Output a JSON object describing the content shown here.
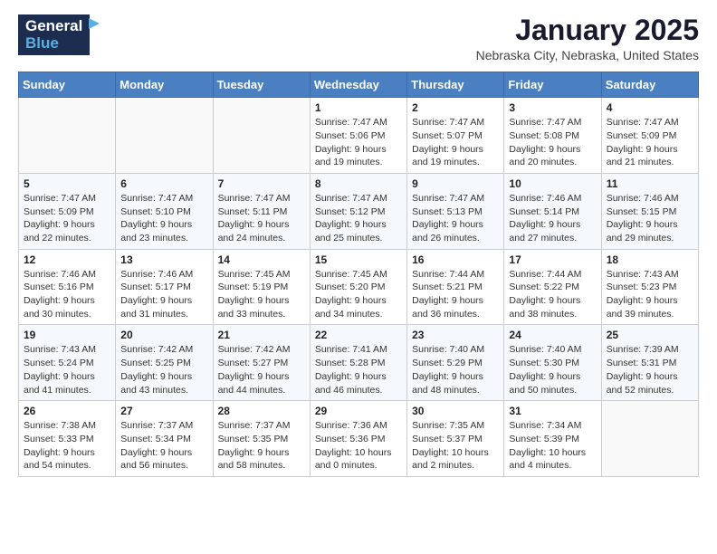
{
  "header": {
    "logo_line1": "General",
    "logo_line2": "Blue",
    "month": "January 2025",
    "location": "Nebraska City, Nebraska, United States"
  },
  "weekdays": [
    "Sunday",
    "Monday",
    "Tuesday",
    "Wednesday",
    "Thursday",
    "Friday",
    "Saturday"
  ],
  "weeks": [
    [
      {
        "day": "",
        "info": ""
      },
      {
        "day": "",
        "info": ""
      },
      {
        "day": "",
        "info": ""
      },
      {
        "day": "1",
        "info": "Sunrise: 7:47 AM\nSunset: 5:06 PM\nDaylight: 9 hours\nand 19 minutes."
      },
      {
        "day": "2",
        "info": "Sunrise: 7:47 AM\nSunset: 5:07 PM\nDaylight: 9 hours\nand 19 minutes."
      },
      {
        "day": "3",
        "info": "Sunrise: 7:47 AM\nSunset: 5:08 PM\nDaylight: 9 hours\nand 20 minutes."
      },
      {
        "day": "4",
        "info": "Sunrise: 7:47 AM\nSunset: 5:09 PM\nDaylight: 9 hours\nand 21 minutes."
      }
    ],
    [
      {
        "day": "5",
        "info": "Sunrise: 7:47 AM\nSunset: 5:09 PM\nDaylight: 9 hours\nand 22 minutes."
      },
      {
        "day": "6",
        "info": "Sunrise: 7:47 AM\nSunset: 5:10 PM\nDaylight: 9 hours\nand 23 minutes."
      },
      {
        "day": "7",
        "info": "Sunrise: 7:47 AM\nSunset: 5:11 PM\nDaylight: 9 hours\nand 24 minutes."
      },
      {
        "day": "8",
        "info": "Sunrise: 7:47 AM\nSunset: 5:12 PM\nDaylight: 9 hours\nand 25 minutes."
      },
      {
        "day": "9",
        "info": "Sunrise: 7:47 AM\nSunset: 5:13 PM\nDaylight: 9 hours\nand 26 minutes."
      },
      {
        "day": "10",
        "info": "Sunrise: 7:46 AM\nSunset: 5:14 PM\nDaylight: 9 hours\nand 27 minutes."
      },
      {
        "day": "11",
        "info": "Sunrise: 7:46 AM\nSunset: 5:15 PM\nDaylight: 9 hours\nand 29 minutes."
      }
    ],
    [
      {
        "day": "12",
        "info": "Sunrise: 7:46 AM\nSunset: 5:16 PM\nDaylight: 9 hours\nand 30 minutes."
      },
      {
        "day": "13",
        "info": "Sunrise: 7:46 AM\nSunset: 5:17 PM\nDaylight: 9 hours\nand 31 minutes."
      },
      {
        "day": "14",
        "info": "Sunrise: 7:45 AM\nSunset: 5:19 PM\nDaylight: 9 hours\nand 33 minutes."
      },
      {
        "day": "15",
        "info": "Sunrise: 7:45 AM\nSunset: 5:20 PM\nDaylight: 9 hours\nand 34 minutes."
      },
      {
        "day": "16",
        "info": "Sunrise: 7:44 AM\nSunset: 5:21 PM\nDaylight: 9 hours\nand 36 minutes."
      },
      {
        "day": "17",
        "info": "Sunrise: 7:44 AM\nSunset: 5:22 PM\nDaylight: 9 hours\nand 38 minutes."
      },
      {
        "day": "18",
        "info": "Sunrise: 7:43 AM\nSunset: 5:23 PM\nDaylight: 9 hours\nand 39 minutes."
      }
    ],
    [
      {
        "day": "19",
        "info": "Sunrise: 7:43 AM\nSunset: 5:24 PM\nDaylight: 9 hours\nand 41 minutes."
      },
      {
        "day": "20",
        "info": "Sunrise: 7:42 AM\nSunset: 5:25 PM\nDaylight: 9 hours\nand 43 minutes."
      },
      {
        "day": "21",
        "info": "Sunrise: 7:42 AM\nSunset: 5:27 PM\nDaylight: 9 hours\nand 44 minutes."
      },
      {
        "day": "22",
        "info": "Sunrise: 7:41 AM\nSunset: 5:28 PM\nDaylight: 9 hours\nand 46 minutes."
      },
      {
        "day": "23",
        "info": "Sunrise: 7:40 AM\nSunset: 5:29 PM\nDaylight: 9 hours\nand 48 minutes."
      },
      {
        "day": "24",
        "info": "Sunrise: 7:40 AM\nSunset: 5:30 PM\nDaylight: 9 hours\nand 50 minutes."
      },
      {
        "day": "25",
        "info": "Sunrise: 7:39 AM\nSunset: 5:31 PM\nDaylight: 9 hours\nand 52 minutes."
      }
    ],
    [
      {
        "day": "26",
        "info": "Sunrise: 7:38 AM\nSunset: 5:33 PM\nDaylight: 9 hours\nand 54 minutes."
      },
      {
        "day": "27",
        "info": "Sunrise: 7:37 AM\nSunset: 5:34 PM\nDaylight: 9 hours\nand 56 minutes."
      },
      {
        "day": "28",
        "info": "Sunrise: 7:37 AM\nSunset: 5:35 PM\nDaylight: 9 hours\nand 58 minutes."
      },
      {
        "day": "29",
        "info": "Sunrise: 7:36 AM\nSunset: 5:36 PM\nDaylight: 10 hours\nand 0 minutes."
      },
      {
        "day": "30",
        "info": "Sunrise: 7:35 AM\nSunset: 5:37 PM\nDaylight: 10 hours\nand 2 minutes."
      },
      {
        "day": "31",
        "info": "Sunrise: 7:34 AM\nSunset: 5:39 PM\nDaylight: 10 hours\nand 4 minutes."
      },
      {
        "day": "",
        "info": ""
      }
    ]
  ]
}
